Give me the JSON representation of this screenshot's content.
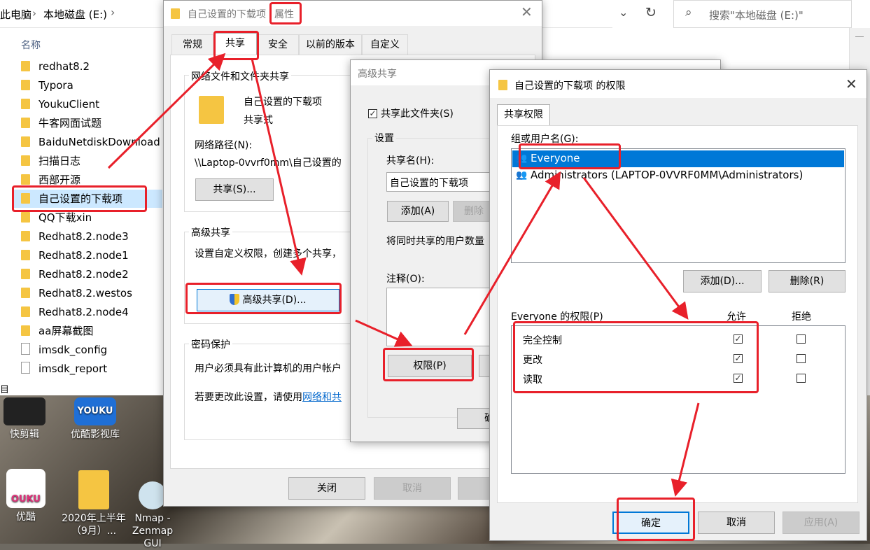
{
  "explorer": {
    "breadcrumb_pc": "此电脑",
    "breadcrumb_drive": "本地磁盘 (E:)",
    "search_placeholder": "搜索\"本地磁盘 (E:)\"",
    "column_name": "名称",
    "items": [
      {
        "name": "redhat8.2",
        "type": "folder"
      },
      {
        "name": "Typora",
        "type": "folder"
      },
      {
        "name": "YoukuClient",
        "type": "folder"
      },
      {
        "name": "牛客网面试题",
        "type": "folder"
      },
      {
        "name": "BaiduNetdiskDownload",
        "type": "folder"
      },
      {
        "name": "扫描日志",
        "type": "folder"
      },
      {
        "name": "西部开源",
        "type": "folder"
      },
      {
        "name": "自己设置的下载项",
        "type": "folder"
      },
      {
        "name": "QQ下载xin",
        "type": "folder"
      },
      {
        "name": "Redhat8.2.node3",
        "type": "folder"
      },
      {
        "name": "Redhat8.2.node1",
        "type": "folder"
      },
      {
        "name": "Redhat8.2.node2",
        "type": "folder"
      },
      {
        "name": "Redhat8.2.westos",
        "type": "folder"
      },
      {
        "name": "Redhat8.2.node4",
        "type": "folder"
      },
      {
        "name": "aa屏幕截图",
        "type": "folder"
      },
      {
        "name": "imsdk_config",
        "type": "file"
      },
      {
        "name": "imsdk_report",
        "type": "file"
      }
    ],
    "status_partial": "目"
  },
  "desktop": {
    "icons": [
      {
        "label": "快剪辑",
        "icon": "kuaijianji-icon"
      },
      {
        "label": "优酷影视库",
        "icon": "youku-library-icon"
      },
      {
        "label": "优酷",
        "icon": "youku-icon"
      },
      {
        "label": "2020年上半年（9月）...",
        "icon": "zip-folder-icon"
      },
      {
        "label": "Nmap - Zenmap GUI",
        "icon": "zenmap-icon"
      }
    ],
    "youku_badge": "YOUKU",
    "ouku_badge": "OUKU"
  },
  "properties": {
    "title_prefix": "自己设置的下载项 ",
    "title_suffix": "属性",
    "tabs": [
      "常规",
      "共享",
      "安全",
      "以前的版本",
      "自定义"
    ],
    "network_group": "网络文件和文件夹共享",
    "folder_name": "自己设置的下载项",
    "share_state": "共享式",
    "net_path_label": "网络路径(N):",
    "net_path_value": "\\\\Laptop-0vvrf0mm\\自己设置的",
    "share_button": "共享(S)...",
    "adv_group": "高级共享",
    "adv_desc": "设置自定义权限，创建多个共享，",
    "adv_button": "高级共享(D)...",
    "pwd_group": "密码保护",
    "pwd_desc1": "用户必须具有此计算机的用户帐户",
    "pwd_desc2_prefix": "若要更改此设置，请使用",
    "pwd_link": "网络和共",
    "close_button": "关闭",
    "cancel_button": "取消",
    "apply_button": "应"
  },
  "advanced": {
    "title": "高级共享",
    "share_checkbox": "共享此文件夹(S)",
    "settings_group": "设置",
    "share_name_label": "共享名(H):",
    "share_name_value": "自己设置的下载项",
    "add_button": "添加(A)",
    "delete_button": "删除",
    "limit_label": "将同时共享的用户数量",
    "comment_label": "注释(O):",
    "permissions_button": "权限(P)",
    "ok_partial": "确"
  },
  "permissions": {
    "title": "自己设置的下载项 的权限",
    "tab": "共享权限",
    "group_label": "组或用户名(G):",
    "users": [
      "Everyone",
      "Administrators (LAPTOP-0VVRF0MM\\Administrators)"
    ],
    "add_button": "添加(D)...",
    "remove_button": "删除(R)",
    "perm_label": "Everyone 的权限(P)",
    "allow_header": "允许",
    "deny_header": "拒绝",
    "rows": [
      {
        "name": "完全控制",
        "allow": true,
        "deny": false
      },
      {
        "name": "更改",
        "allow": true,
        "deny": false
      },
      {
        "name": "读取",
        "allow": true,
        "deny": false
      }
    ],
    "ok_button": "确定",
    "cancel_button": "取消",
    "apply_button": "应用(A)"
  },
  "colors": {
    "annotation": "#e8202a",
    "selection": "#0078d7",
    "folder": "#f5c542"
  }
}
